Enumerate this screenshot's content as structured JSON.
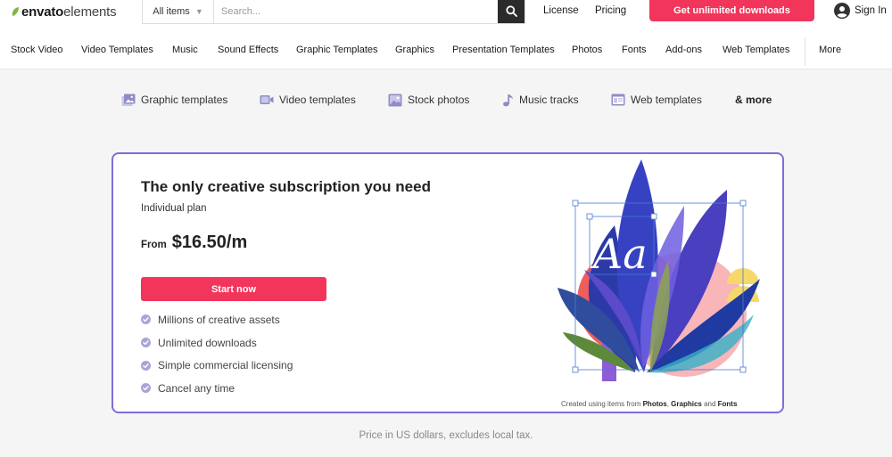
{
  "header": {
    "logo": {
      "word1": "envato",
      "word2": "elements"
    },
    "search": {
      "category": "All items",
      "placeholder": "Search..."
    },
    "links": {
      "license": "License",
      "pricing": "Pricing"
    },
    "cta": "Get unlimited downloads",
    "sign_in": "Sign In"
  },
  "category_nav": {
    "items": [
      "Stock Video",
      "Video Templates",
      "Music",
      "Sound Effects",
      "Graphic Templates",
      "Graphics",
      "Presentation Templates",
      "Photos",
      "Fonts",
      "Add-ons",
      "Web Templates"
    ],
    "more": "More"
  },
  "quick_links": {
    "graphic": "Graphic templates",
    "video": "Video templates",
    "photos": "Stock photos",
    "music": "Music tracks",
    "web": "Web templates",
    "more": "& more"
  },
  "card": {
    "title": "The only creative subscription you need",
    "plan": "Individual plan",
    "price_from": "From",
    "price": "$16.50/m",
    "button": "Start now",
    "features": [
      "Millions of creative assets",
      "Unlimited downloads",
      "Simple commercial licensing",
      "Cancel any time"
    ],
    "artwork_text": "Aa",
    "credit": {
      "prefix": "Created using items from ",
      "photos": "Photos",
      "sep": ", ",
      "graphics": "Graphics",
      "and": " and ",
      "fonts": "Fonts"
    }
  },
  "disclaimer": "Price in US dollars, excludes local tax.",
  "colors": {
    "brand_green": "#82b541",
    "cta_red": "#f2355b",
    "card_border": "#7b6fd8",
    "check": "#a8a5d9",
    "quick_icon": "#8f8cc4"
  },
  "icons": [
    "leaf-icon",
    "chevron-down-icon",
    "search-icon",
    "user-icon",
    "image-icon",
    "video-icon",
    "photo-icon",
    "music-note-icon",
    "web-icon",
    "check-circle-icon"
  ]
}
